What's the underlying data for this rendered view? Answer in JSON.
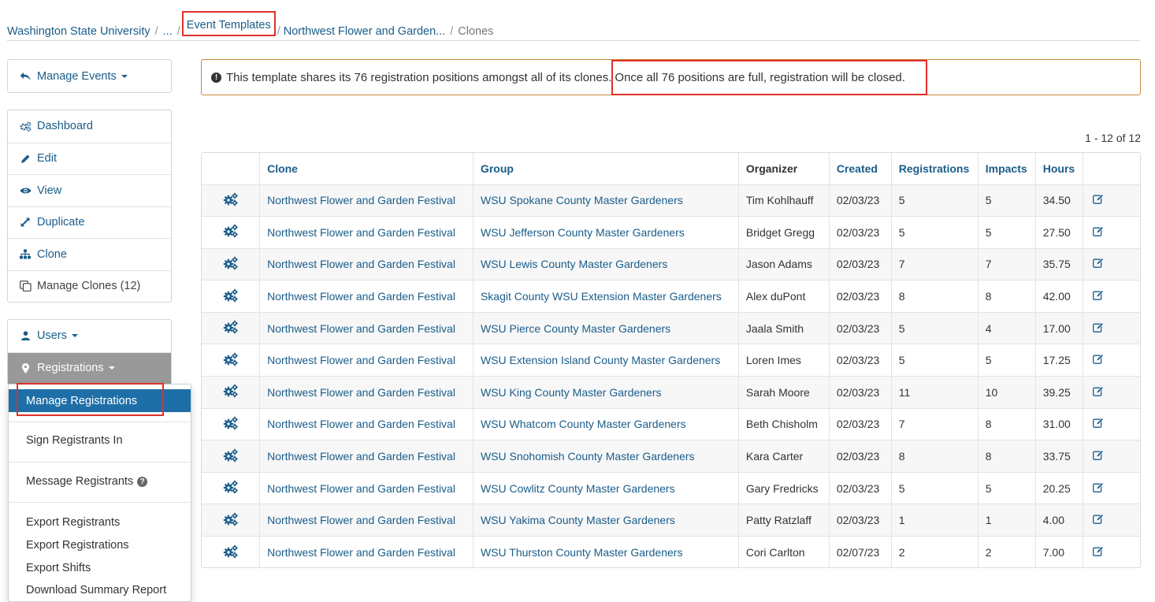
{
  "breadcrumb": {
    "items": [
      "Washington State University",
      "...",
      "Event Templates",
      "Northwest Flower and Garden...",
      "Clones"
    ],
    "separator": "/"
  },
  "sidebar": {
    "manage_events": "Manage Events",
    "nav": [
      "Dashboard",
      "Edit",
      "View",
      "Duplicate",
      "Clone",
      "Manage Clones (12)"
    ],
    "users": "Users",
    "registrations": "Registrations"
  },
  "dropdown": {
    "items": [
      "Manage Registrations",
      "Sign Registrants In",
      "Message Registrants",
      "Export Registrants",
      "Export Registrations",
      "Export Shifts",
      "Download Summary Report"
    ]
  },
  "alert": {
    "text": "This template shares its 76 registration positions amongst all of its clones.",
    "highlight": "Once all 76 positions are full, registration will be closed."
  },
  "pager": "1 - 12 of 12",
  "table": {
    "headers": [
      "Clone",
      "Group",
      "Organizer",
      "Created",
      "Registrations",
      "Impacts",
      "Hours"
    ],
    "rows": [
      [
        "Northwest Flower and Garden Festival",
        "WSU Spokane County Master Gardeners",
        "Tim Kohlhauff",
        "02/03/23",
        "5",
        "5",
        "34.50"
      ],
      [
        "Northwest Flower and Garden Festival",
        "WSU Jefferson County Master Gardeners",
        "Bridget Gregg",
        "02/03/23",
        "5",
        "5",
        "27.50"
      ],
      [
        "Northwest Flower and Garden Festival",
        "WSU Lewis County Master Gardeners",
        "Jason Adams",
        "02/03/23",
        "7",
        "7",
        "35.75"
      ],
      [
        "Northwest Flower and Garden Festival",
        "Skagit County WSU Extension Master Gardeners",
        "Alex duPont",
        "02/03/23",
        "8",
        "8",
        "42.00"
      ],
      [
        "Northwest Flower and Garden Festival",
        "WSU Pierce County Master Gardeners",
        "Jaala Smith",
        "02/03/23",
        "5",
        "4",
        "17.00"
      ],
      [
        "Northwest Flower and Garden Festival",
        "WSU Extension Island County Master Gardeners",
        "Loren Imes",
        "02/03/23",
        "5",
        "5",
        "17.25"
      ],
      [
        "Northwest Flower and Garden Festival",
        "WSU King County Master Gardeners",
        "Sarah Moore",
        "02/03/23",
        "11",
        "10",
        "39.25"
      ],
      [
        "Northwest Flower and Garden Festival",
        "WSU Whatcom County Master Gardeners",
        "Beth Chisholm",
        "02/03/23",
        "7",
        "8",
        "31.00"
      ],
      [
        "Northwest Flower and Garden Festival",
        "WSU Snohomish County Master Gardeners",
        "Kara Carter",
        "02/03/23",
        "8",
        "8",
        "33.75"
      ],
      [
        "Northwest Flower and Garden Festival",
        "WSU Cowlitz County Master Gardeners",
        "Gary Fredricks",
        "02/03/23",
        "5",
        "5",
        "20.25"
      ],
      [
        "Northwest Flower and Garden Festival",
        "WSU Yakima County Master Gardeners",
        "Patty Ratzlaff",
        "02/03/23",
        "1",
        "1",
        "4.00"
      ],
      [
        "Northwest Flower and Garden Festival",
        "WSU Thurston County Master Gardeners",
        "Cori Carlton",
        "02/07/23",
        "2",
        "2",
        "7.00"
      ]
    ]
  },
  "icons": {
    "row_action": "gears-icon",
    "row_edit": "edit-icon"
  },
  "colors": {
    "link": "#1a5d8a",
    "active_menu": "#1e6fa8",
    "alert_border": "#c8893c",
    "highlight_box": "#e0302a"
  }
}
